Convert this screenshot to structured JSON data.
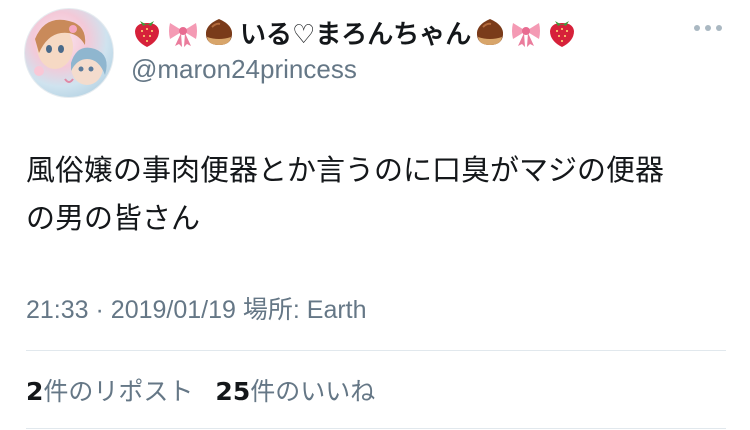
{
  "user": {
    "display_name": "いる♡まろんちゃん",
    "handle": "@maron24princess",
    "name_emojis_left": [
      "strawberry-icon",
      "ribbon-icon",
      "chestnut-icon"
    ],
    "name_emojis_right": [
      "chestnut-icon",
      "ribbon-icon",
      "strawberry-icon"
    ]
  },
  "tweet": {
    "text_line1": "風俗嬢の事肉便器とか言うのに口臭がマジの便器",
    "text_line2": "の男の皆さん",
    "time": "21:33",
    "separator": "·",
    "date": "2019/01/19",
    "location_label": "場所: Earth"
  },
  "stats": {
    "retweets_count": "2",
    "retweets_label": "件のリポスト",
    "likes_count": "25",
    "likes_label": "件のいいね"
  },
  "colors": {
    "text": "#14171a",
    "secondary": "#657786",
    "divider": "#e1e8ed"
  }
}
